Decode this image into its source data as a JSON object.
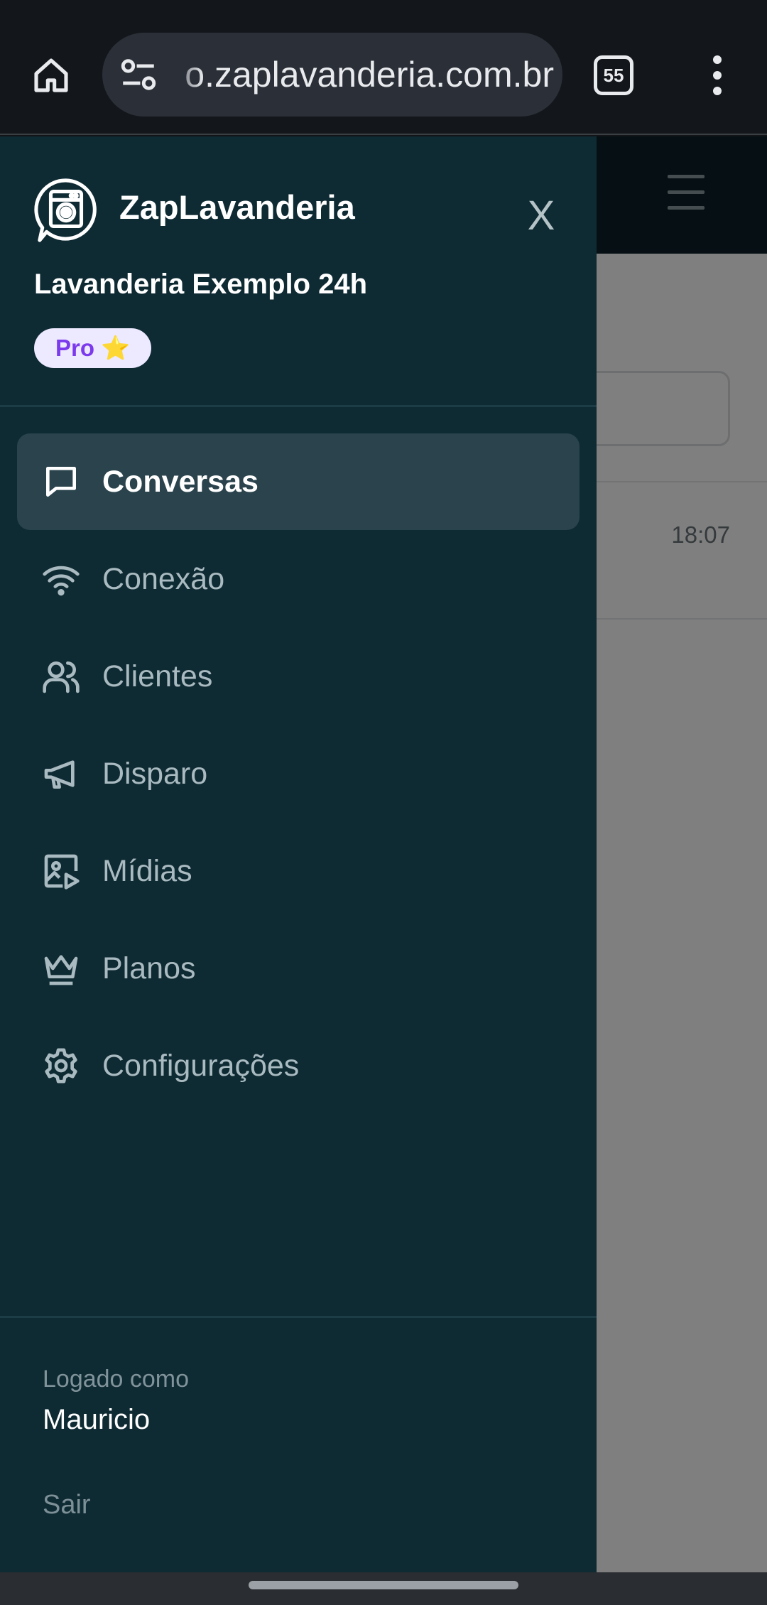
{
  "browser": {
    "url": "o.zaplavanderia.com.br",
    "tab_count": "55"
  },
  "app": {
    "row_time": "18:07"
  },
  "drawer": {
    "brand": "ZapLavanderia",
    "close_label": "X",
    "business_name": "Lavanderia Exemplo 24h",
    "plan_badge": "Pro ⭐",
    "nav": [
      {
        "label": "Conversas",
        "icon": "chat-icon",
        "active": true
      },
      {
        "label": "Conexão",
        "icon": "wifi-icon",
        "active": false
      },
      {
        "label": "Clientes",
        "icon": "users-icon",
        "active": false
      },
      {
        "label": "Disparo",
        "icon": "megaphone-icon",
        "active": false
      },
      {
        "label": "Mídias",
        "icon": "media-icon",
        "active": false
      },
      {
        "label": "Planos",
        "icon": "crown-icon",
        "active": false
      },
      {
        "label": "Configurações",
        "icon": "gear-icon",
        "active": false
      }
    ],
    "logged_label": "Logado como",
    "logged_user": "Mauricio",
    "logout_label": "Sair"
  },
  "colors": {
    "drawer_bg": "#0e2a33",
    "active_item_bg": "#2a434c",
    "badge_bg": "#ede9fe",
    "badge_text": "#7c3aed"
  }
}
